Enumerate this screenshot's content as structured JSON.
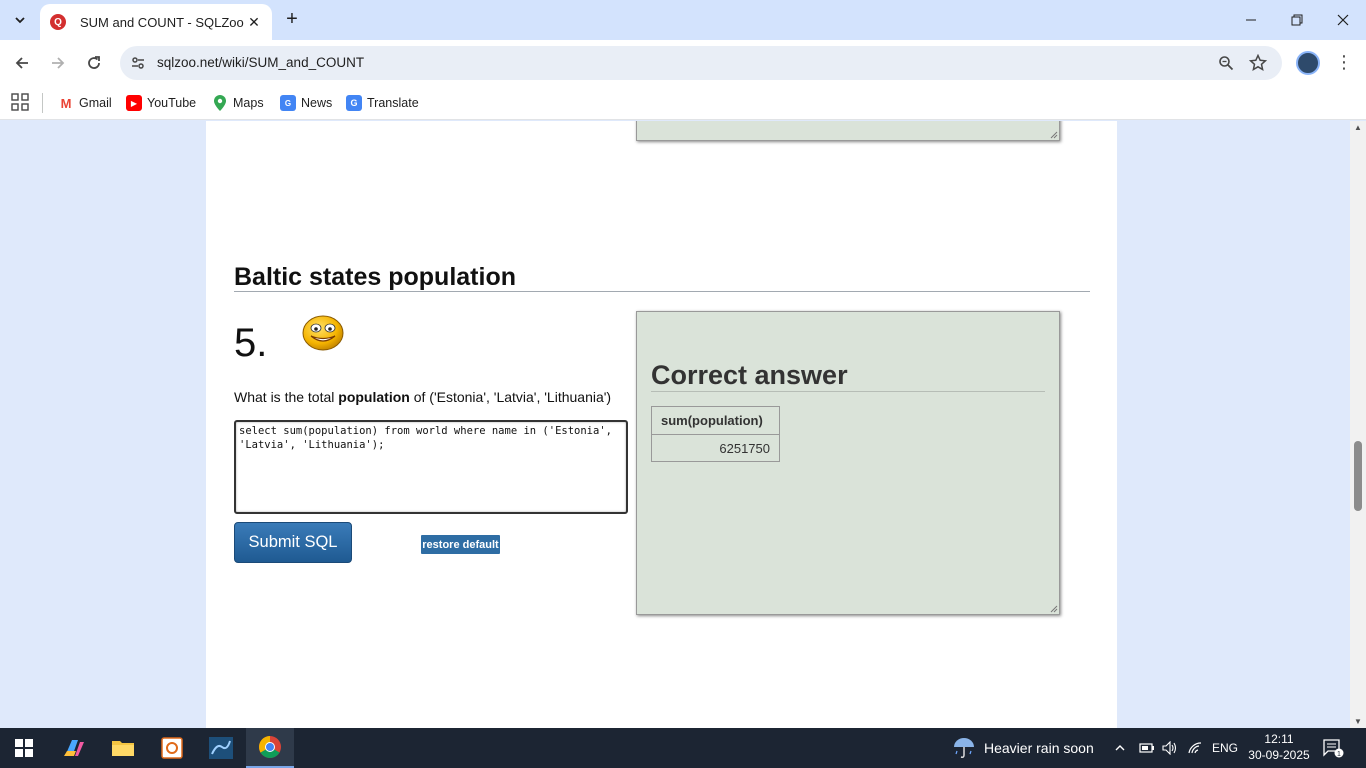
{
  "browser": {
    "tab_title": "SUM and COUNT - SQLZoo",
    "url": "sqlzoo.net/wiki/SUM_and_COUNT",
    "bookmarks": [
      {
        "label": "Gmail",
        "icon": "gmail-icon",
        "color": "#ea4335"
      },
      {
        "label": "YouTube",
        "icon": "youtube-icon",
        "color": "#ff0000"
      },
      {
        "label": "Maps",
        "icon": "maps-icon",
        "color": "#34a853"
      },
      {
        "label": "News",
        "icon": "news-icon",
        "color": "#4285f4"
      },
      {
        "label": "Translate",
        "icon": "translate-icon",
        "color": "#4285f4"
      }
    ]
  },
  "section": {
    "heading": "Baltic states population",
    "number": "5.",
    "question_prefix": "What is the total ",
    "question_bold": "population",
    "question_suffix": " of ('Estonia', 'Latvia', 'Lithuania')",
    "sql": "select sum(population) from world where name in ('Estonia', 'Latvia', 'Lithuania');",
    "submit_label": "Submit SQL",
    "restore_label": "restore default"
  },
  "answer": {
    "title": "Correct answer",
    "column": "sum(population)",
    "value": "6251750"
  },
  "taskbar": {
    "weather": "Heavier rain soon",
    "language": "ENG",
    "time": "12:11",
    "date": "30-09-2025",
    "notifications": "1"
  },
  "colors": {
    "answer_bg": "#dae3d9",
    "submit_bg": "#2e6da4",
    "tabstrip_bg": "#d3e3fd"
  }
}
